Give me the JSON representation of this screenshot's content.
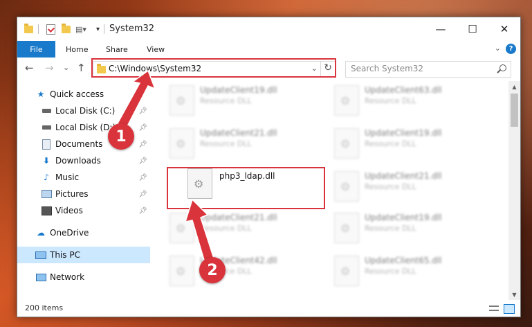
{
  "window": {
    "title": "System32",
    "controls": {
      "minimize": "—",
      "maximize": "☐",
      "close": "✕"
    }
  },
  "ribbon": {
    "tabs": [
      "File",
      "Home",
      "Share",
      "View"
    ],
    "help": "?"
  },
  "navigation": {
    "back": "←",
    "forward": "→",
    "recent": "⌄",
    "up": "↑",
    "address": "C:\\Windows\\System32",
    "refresh": "↻",
    "search_placeholder": "Search System32"
  },
  "sidebar": {
    "items": [
      {
        "label": "Quick access",
        "icon": "star-icon",
        "pinned": false
      },
      {
        "label": "Local Disk (C:)",
        "icon": "drive-icon",
        "pinned": true
      },
      {
        "label": "Local Disk (D:)",
        "icon": "drive-icon",
        "pinned": true
      },
      {
        "label": "Documents",
        "icon": "documents-icon",
        "pinned": true
      },
      {
        "label": "Downloads",
        "icon": "downloads-icon",
        "pinned": true
      },
      {
        "label": "Music",
        "icon": "music-icon",
        "pinned": true
      },
      {
        "label": "Pictures",
        "icon": "pictures-icon",
        "pinned": true
      },
      {
        "label": "Videos",
        "icon": "videos-icon",
        "pinned": true
      },
      {
        "label": "OneDrive",
        "icon": "cloud-icon",
        "pinned": false
      },
      {
        "label": "This PC",
        "icon": "pc-icon",
        "pinned": false,
        "selected": true
      },
      {
        "label": "Network",
        "icon": "network-icon",
        "pinned": false
      }
    ]
  },
  "files": [
    {
      "name": "UpdateClient19.dll",
      "type": "Resource DLL"
    },
    {
      "name": "UpdateClient63.dll",
      "type": "Resource DLL"
    },
    {
      "name": "UpdateClient21.dll",
      "type": "Resource DLL"
    },
    {
      "name": "UpdateClient19.dll",
      "type": "Resource DLL"
    },
    {
      "name": "php3_ldap.dll",
      "type": ""
    },
    {
      "name": "UpdateClient21.dll",
      "type": "Resource DLL"
    },
    {
      "name": "UpdateClient21.dll",
      "type": "Resource DLL"
    },
    {
      "name": "UpdateClient19.dll",
      "type": "Resource DLL"
    },
    {
      "name": "UpdateClient42.dll",
      "type": "Resource DLL"
    },
    {
      "name": "UpdateClient65.dll",
      "type": "Resource DLL"
    }
  ],
  "status": {
    "item_count": "200 items"
  },
  "annotations": {
    "step1": "1",
    "step2": "2",
    "color": "#d9333b"
  }
}
